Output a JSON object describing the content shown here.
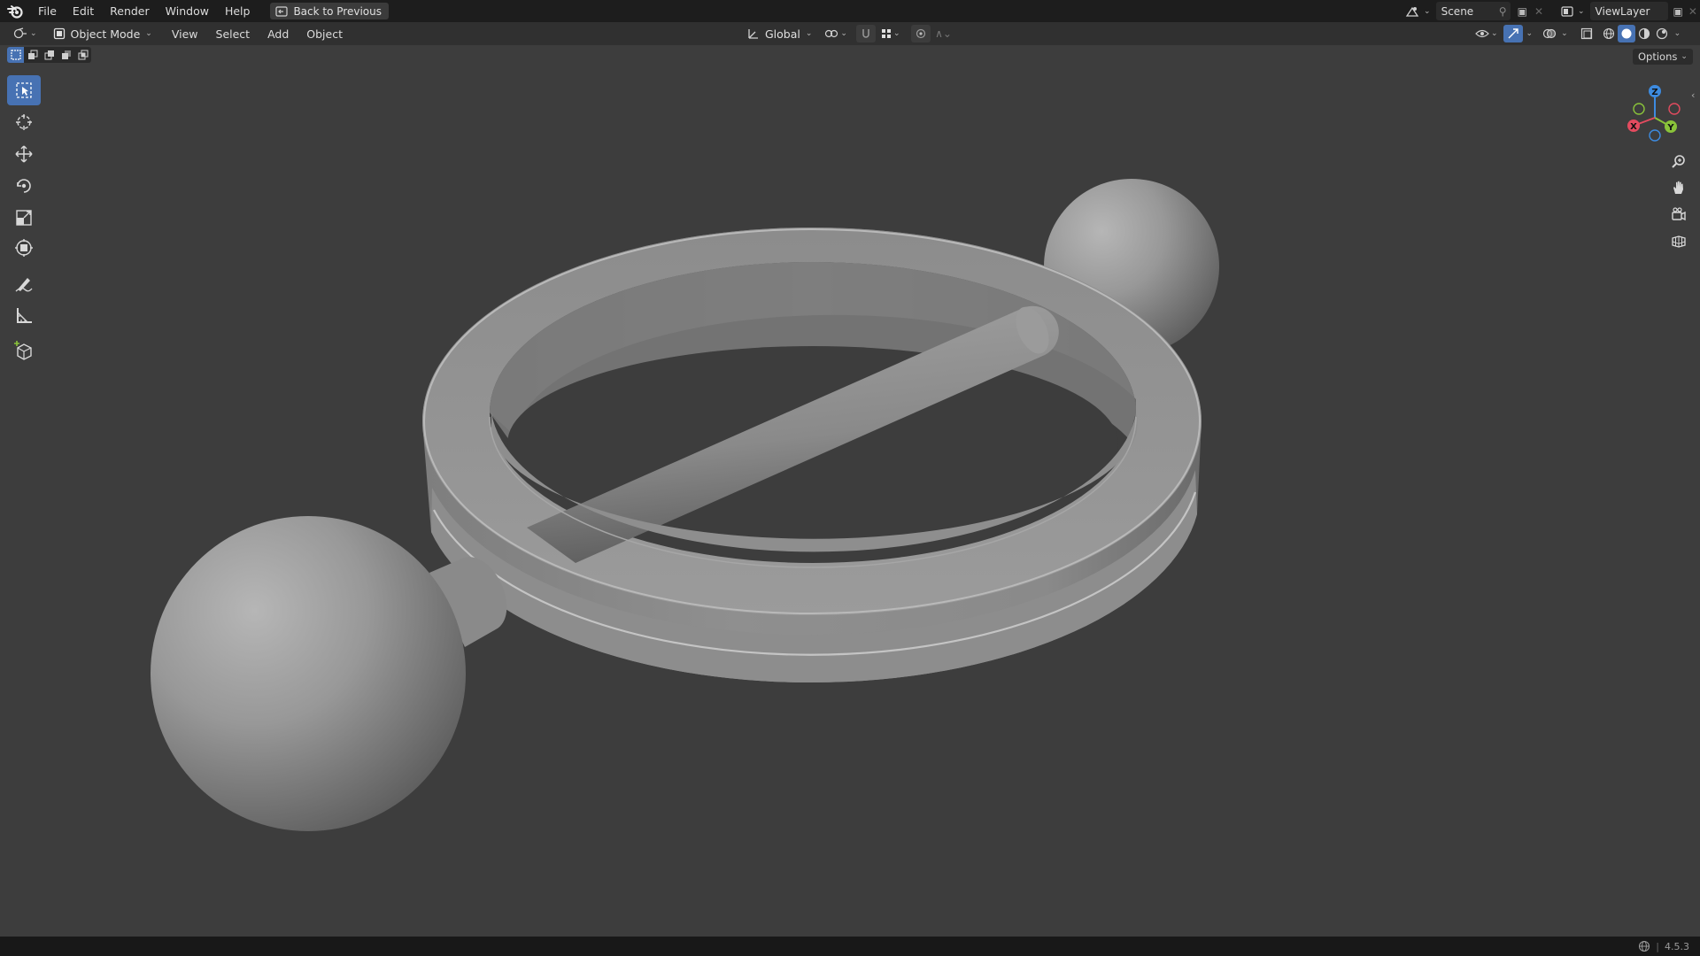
{
  "app": {
    "menu": [
      "File",
      "Edit",
      "Render",
      "Window",
      "Help"
    ],
    "back_button": "Back to Previous",
    "scene": "Scene",
    "view_layer": "ViewLayer"
  },
  "header": {
    "mode": "Object Mode",
    "menus": [
      "View",
      "Select",
      "Add",
      "Object"
    ],
    "transform_orientation": "Global",
    "options_label": "Options"
  },
  "gizmo": {
    "x": "X",
    "y": "Y",
    "z": "Z"
  },
  "status": {
    "version": "4.5.3"
  },
  "colors": {
    "accent": "#4772b3",
    "axis_x": "#e34b5f",
    "axis_y": "#8ac33a",
    "axis_z": "#3d8be0"
  },
  "icons": {
    "tools": [
      "select-box-icon",
      "cursor-icon",
      "move-icon",
      "rotate-icon",
      "scale-icon",
      "transform-icon",
      "annotate-icon",
      "measure-icon",
      "add-cube-icon"
    ],
    "nav": [
      "zoom-icon",
      "pan-hand-icon",
      "camera-icon",
      "grid-ortho-icon"
    ]
  }
}
